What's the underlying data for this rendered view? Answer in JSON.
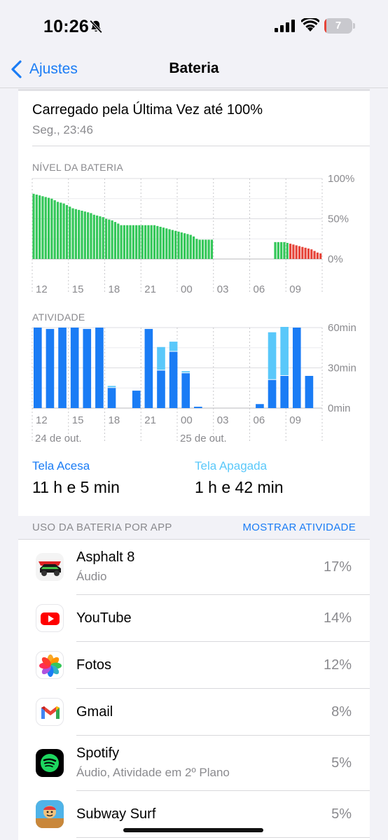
{
  "status_bar": {
    "time": "10:26",
    "battery_level": "7",
    "battery_color": "#e6453a"
  },
  "nav": {
    "back_label": "Ajustes",
    "title": "Bateria"
  },
  "last_charge": {
    "title": "Carregado pela Última Vez até 100%",
    "subtitle": "Seg., 23:46"
  },
  "chart_data": [
    {
      "type": "bar",
      "title": "NÍVEL DA BATERIA",
      "y_ticks": [
        "100%",
        "50%",
        "0%"
      ],
      "ylim": [
        0,
        100
      ],
      "x_tick_labels": [
        "12",
        "15",
        "18",
        "21",
        "00",
        "03",
        "06",
        "09"
      ],
      "colors": {
        "charged": "#34c759",
        "low": "#e6453a"
      },
      "series": [
        {
          "values": [
            81,
            80,
            79,
            78,
            77,
            76,
            75,
            73,
            71,
            70,
            69,
            67,
            65,
            63,
            62,
            61,
            60,
            59,
            58,
            57,
            55,
            54,
            53,
            52,
            50,
            49,
            48,
            46,
            44,
            42,
            42,
            42,
            42,
            42,
            42,
            42,
            42,
            42,
            42,
            42,
            42,
            41,
            40,
            39,
            38,
            37,
            36,
            35,
            34,
            33,
            32,
            31,
            30,
            28,
            25,
            24,
            24,
            24,
            24,
            24,
            null,
            null,
            null,
            null,
            null,
            null,
            null,
            null,
            null,
            null,
            null,
            null,
            null,
            null,
            null,
            null,
            null,
            null,
            null,
            null,
            21,
            21,
            21,
            21,
            20,
            19,
            18,
            17,
            16,
            15,
            14,
            13,
            12,
            10,
            8,
            7
          ],
          "low_start_index": 85
        }
      ]
    },
    {
      "type": "bar",
      "title": "ATIVIDADE",
      "y_ticks": [
        "60min",
        "30min",
        "0min"
      ],
      "ylim": [
        0,
        60
      ],
      "x_tick_labels": [
        "12",
        "15",
        "18",
        "21",
        "00",
        "03",
        "06",
        "09"
      ],
      "date_labels": [
        "24 de out.",
        "25 de out."
      ],
      "series": [
        {
          "name": "Tela Acesa",
          "color": "#1a7cf5",
          "values": [
            60,
            59,
            60,
            60,
            59,
            60,
            15,
            0,
            13,
            59,
            28,
            42,
            26,
            1,
            0,
            0,
            0,
            0,
            3,
            21,
            24,
            60,
            24
          ]
        },
        {
          "name": "Tela Apagada",
          "color": "#5ac8fa",
          "values": [
            0,
            0,
            0,
            0,
            0,
            0,
            1,
            0,
            0,
            0,
            17,
            7,
            1,
            0,
            0,
            0,
            0,
            0,
            0,
            35,
            36,
            0,
            0
          ]
        }
      ]
    }
  ],
  "activity_summary": {
    "screen_on_label": "Tela Acesa",
    "screen_on_value": "11 h e 5 min",
    "screen_off_label": "Tela Apagada",
    "screen_off_value": "1 h e 42 min"
  },
  "usage": {
    "header": "USO DA BATERIA POR APP",
    "action": "MOSTRAR ATIVIDADE",
    "apps": [
      {
        "name": "Asphalt 8",
        "sub": "Áudio",
        "percent": "17%",
        "icon": "asphalt-icon"
      },
      {
        "name": "YouTube",
        "sub": "",
        "percent": "14%",
        "icon": "youtube-icon"
      },
      {
        "name": "Fotos",
        "sub": "",
        "percent": "12%",
        "icon": "photos-icon"
      },
      {
        "name": "Gmail",
        "sub": "",
        "percent": "8%",
        "icon": "gmail-icon"
      },
      {
        "name": "Spotify",
        "sub": "Áudio, Atividade em 2º Plano",
        "percent": "5%",
        "icon": "spotify-icon"
      },
      {
        "name": "Subway Surf",
        "sub": "",
        "percent": "5%",
        "icon": "subway-surf-icon"
      }
    ]
  }
}
